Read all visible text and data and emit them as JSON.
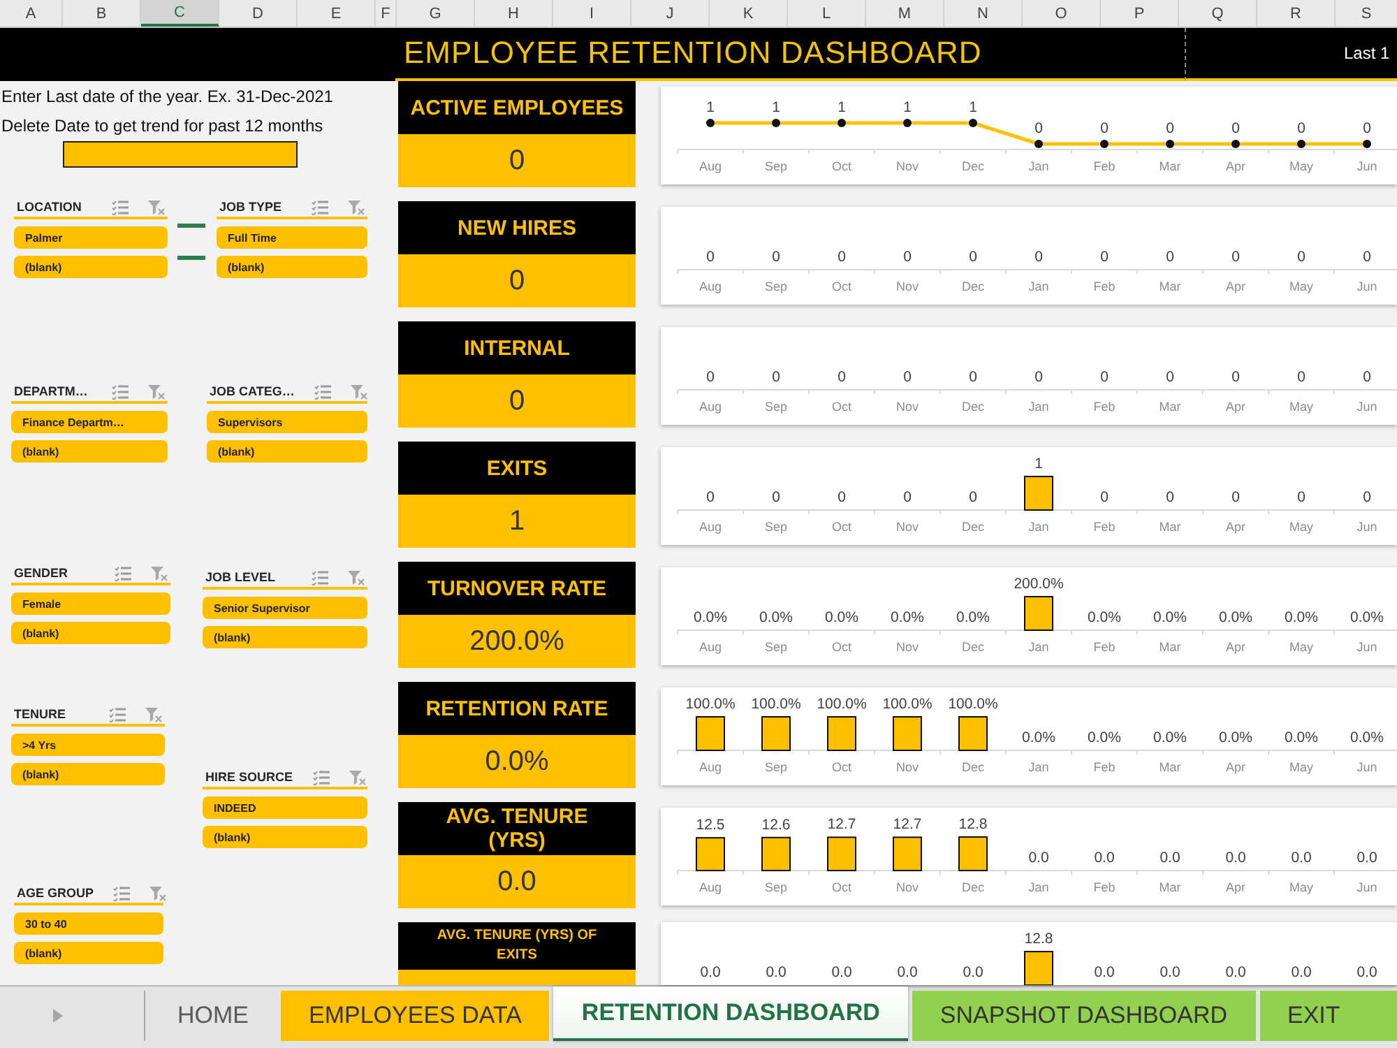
{
  "column_headers": [
    {
      "label": "A",
      "selected": false
    },
    {
      "label": "B",
      "selected": false
    },
    {
      "label": "C",
      "selected": true
    },
    {
      "label": "D",
      "selected": false
    },
    {
      "label": "E",
      "selected": false
    },
    {
      "label": "F",
      "selected": false
    },
    {
      "label": "G",
      "selected": false
    },
    {
      "label": "H",
      "selected": false
    },
    {
      "label": "I",
      "selected": false
    },
    {
      "label": "J",
      "selected": false
    },
    {
      "label": "K",
      "selected": false
    },
    {
      "label": "L",
      "selected": false
    },
    {
      "label": "M",
      "selected": false
    },
    {
      "label": "N",
      "selected": false
    },
    {
      "label": "O",
      "selected": false
    },
    {
      "label": "P",
      "selected": false
    },
    {
      "label": "Q",
      "selected": false
    },
    {
      "label": "R",
      "selected": false
    },
    {
      "label": "S",
      "selected": false
    }
  ],
  "header": {
    "title": "EMPLOYEE RETENTION DASHBOARD",
    "period_label": "Last 1"
  },
  "date_panel": {
    "instructions": [
      "Enter Last date of the year. Ex. 31-Dec-2021",
      "Delete Date to get trend for past 12 months"
    ]
  },
  "slicers": [
    {
      "title": "LOCATION",
      "items": [
        {
          "label": "Palmer",
          "selected": true
        },
        {
          "label": "(blank)",
          "selected": true
        }
      ]
    },
    {
      "title": "JOB TYPE",
      "items": [
        {
          "label": "Full Time",
          "selected": true
        },
        {
          "label": "(blank)",
          "selected": true
        }
      ]
    },
    {
      "title": "DEPARTM…",
      "items": [
        {
          "label": "Finance Departm…",
          "selected": true
        },
        {
          "label": "(blank)",
          "selected": true
        }
      ]
    },
    {
      "title": "JOB CATEG…",
      "items": [
        {
          "label": "Supervisors",
          "selected": true
        },
        {
          "label": "(blank)",
          "selected": true
        }
      ]
    },
    {
      "title": "GENDER",
      "items": [
        {
          "label": "Female",
          "selected": true
        },
        {
          "label": "(blank)",
          "selected": true
        }
      ]
    },
    {
      "title": "JOB LEVEL",
      "items": [
        {
          "label": "Senior Supervisor",
          "selected": true
        },
        {
          "label": "(blank)",
          "selected": true
        }
      ]
    },
    {
      "title": "TENURE",
      "items": [
        {
          "label": ">4 Yrs",
          "selected": true
        },
        {
          "label": "(blank)",
          "selected": true
        }
      ]
    },
    {
      "title": "HIRE SOURCE",
      "items": [
        {
          "label": "INDEED",
          "selected": true
        },
        {
          "label": "(blank)",
          "selected": true
        }
      ]
    },
    {
      "title": "AGE GROUP",
      "items": [
        {
          "label": "30 to 40",
          "selected": true
        },
        {
          "label": "(blank)",
          "selected": true
        }
      ]
    }
  ],
  "kpis": [
    {
      "title": "ACTIVE EMPLOYEES",
      "value": "0",
      "chart_data": {
        "type": "line",
        "marker": "circle",
        "categories": [
          "Aug",
          "Sep",
          "Oct",
          "Nov",
          "Dec",
          "Jan",
          "Feb",
          "Mar",
          "Apr",
          "May",
          "Jun"
        ],
        "values": [
          1,
          1,
          1,
          1,
          1,
          0,
          0,
          0,
          0,
          0,
          0
        ],
        "value_labels": [
          "1",
          "1",
          "1",
          "1",
          "1",
          "0",
          "0",
          "0",
          "0",
          "0",
          "0"
        ]
      }
    },
    {
      "title": "NEW HIRES",
      "value": "0",
      "monthly": [
        {
          "month": "Aug",
          "value": "0"
        },
        {
          "month": "Sep",
          "value": "0"
        },
        {
          "month": "Oct",
          "value": "0"
        },
        {
          "month": "Nov",
          "value": "0"
        },
        {
          "month": "Dec",
          "value": "0"
        },
        {
          "month": "Jan",
          "value": "0"
        },
        {
          "month": "Feb",
          "value": "0"
        },
        {
          "month": "Mar",
          "value": "0"
        },
        {
          "month": "Apr",
          "value": "0"
        },
        {
          "month": "May",
          "value": "0"
        },
        {
          "month": "Jun",
          "value": "0"
        }
      ]
    },
    {
      "title": "INTERNAL",
      "value": "0",
      "monthly": [
        {
          "month": "Aug",
          "value": "0"
        },
        {
          "month": "Sep",
          "value": "0"
        },
        {
          "month": "Oct",
          "value": "0"
        },
        {
          "month": "Nov",
          "value": "0"
        },
        {
          "month": "Dec",
          "value": "0"
        },
        {
          "month": "Jan",
          "value": "0"
        },
        {
          "month": "Feb",
          "value": "0"
        },
        {
          "month": "Mar",
          "value": "0"
        },
        {
          "month": "Apr",
          "value": "0"
        },
        {
          "month": "May",
          "value": "0"
        },
        {
          "month": "Jun",
          "value": "0"
        }
      ]
    },
    {
      "title": "EXITS",
      "value": "1",
      "chart_data": {
        "type": "bar",
        "categories": [
          "Aug",
          "Sep",
          "Oct",
          "Nov",
          "Dec",
          "Jan",
          "Feb",
          "Mar",
          "Apr",
          "May",
          "Jun"
        ],
        "values": [
          0,
          0,
          0,
          0,
          0,
          1,
          0,
          0,
          0,
          0,
          0
        ],
        "value_labels": [
          "0",
          "0",
          "0",
          "0",
          "0",
          "1",
          "0",
          "0",
          "0",
          "0",
          "0"
        ]
      }
    },
    {
      "title": "TURNOVER RATE",
      "value": "200.0%",
      "chart_data": {
        "type": "bar",
        "categories": [
          "Aug",
          "Sep",
          "Oct",
          "Nov",
          "Dec",
          "Jan",
          "Feb",
          "Mar",
          "Apr",
          "May",
          "Jun"
        ],
        "values": [
          0,
          0,
          0,
          0,
          0,
          200,
          0,
          0,
          0,
          0,
          0
        ],
        "value_labels": [
          "0.0%",
          "0.0%",
          "0.0%",
          "0.0%",
          "0.0%",
          "200.0%",
          "0.0%",
          "0.0%",
          "0.0%",
          "0.0%",
          "0.0%"
        ]
      }
    },
    {
      "title": "RETENTION RATE",
      "value": "0.0%",
      "chart_data": {
        "type": "bar",
        "categories": [
          "Aug",
          "Sep",
          "Oct",
          "Nov",
          "Dec",
          "Jan",
          "Feb",
          "Mar",
          "Apr",
          "May",
          "Jun"
        ],
        "values": [
          100,
          100,
          100,
          100,
          100,
          0,
          0,
          0,
          0,
          0,
          0
        ],
        "value_labels": [
          "100.0%",
          "100.0%",
          "100.0%",
          "100.0%",
          "100.0%",
          "0.0%",
          "0.0%",
          "0.0%",
          "0.0%",
          "0.0%",
          "0.0%"
        ]
      }
    },
    {
      "title": "AVG. TENURE (YRS)",
      "value": "0.0",
      "chart_data": {
        "type": "bar",
        "categories": [
          "Aug",
          "Sep",
          "Oct",
          "Nov",
          "Dec",
          "Jan",
          "Feb",
          "Mar",
          "Apr",
          "May",
          "Jun"
        ],
        "values": [
          12.5,
          12.6,
          12.7,
          12.7,
          12.8,
          0,
          0,
          0,
          0,
          0,
          0
        ],
        "value_labels": [
          "12.5",
          "12.6",
          "12.7",
          "12.7",
          "12.8",
          "0.0",
          "0.0",
          "0.0",
          "0.0",
          "0.0",
          "0.0"
        ]
      }
    },
    {
      "title": "AVG. TENURE (YRS) OF EXITS",
      "chart_data": {
        "type": "bar",
        "categories": [
          null,
          null,
          null,
          null,
          null,
          null,
          null,
          null,
          null,
          null,
          null
        ],
        "values": [
          0,
          0,
          0,
          0,
          0,
          12.8,
          0,
          0,
          0,
          0,
          0
        ],
        "value_labels": [
          "0.0",
          "0.0",
          "0.0",
          "0.0",
          "0.0",
          "12.8",
          "0.0",
          "0.0",
          "0.0",
          "0.0",
          "0.0"
        ]
      }
    }
  ],
  "sheet_tabs": [
    {
      "label": "HOME",
      "selected": false
    },
    {
      "label": "EMPLOYEES DATA",
      "selected": false,
      "color": "#ffc000"
    },
    {
      "label": "RETENTION DASHBOARD",
      "selected": true
    },
    {
      "label": "SNAPSHOT DASHBOARD",
      "selected": false,
      "color": "#92d050"
    },
    {
      "label": "EXIT",
      "selected": false,
      "color": "#92d050"
    }
  ]
}
